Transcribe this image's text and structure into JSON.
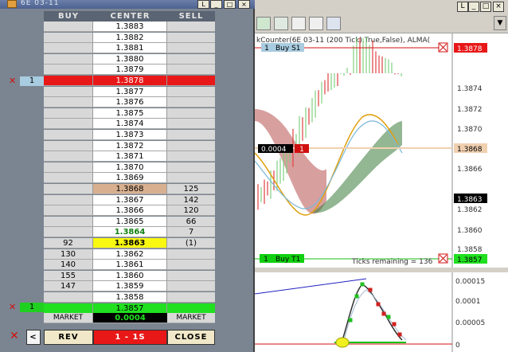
{
  "dom_window": {
    "title": "6E 03-11",
    "headers": {
      "buy": "BUY",
      "center": "CENTER",
      "sell": "SELL"
    },
    "rows": [
      {
        "buy": "",
        "price": "1.3883",
        "sell": "",
        "highlight": ""
      },
      {
        "buy": "",
        "price": "1.3882",
        "sell": "",
        "highlight": ""
      },
      {
        "buy": "",
        "price": "1.3881",
        "sell": "",
        "highlight": ""
      },
      {
        "buy": "",
        "price": "1.3880",
        "sell": "",
        "highlight": ""
      },
      {
        "buy": "",
        "price": "1.3879",
        "sell": "",
        "highlight": ""
      },
      {
        "buy": "",
        "price": "1.3878",
        "sell": "",
        "highlight": "red"
      },
      {
        "buy": "",
        "price": "1.3877",
        "sell": "",
        "highlight": ""
      },
      {
        "buy": "",
        "price": "1.3876",
        "sell": "",
        "highlight": ""
      },
      {
        "buy": "",
        "price": "1.3875",
        "sell": "",
        "highlight": ""
      },
      {
        "buy": "",
        "price": "1.3874",
        "sell": "",
        "highlight": ""
      },
      {
        "buy": "",
        "price": "1.3873",
        "sell": "",
        "highlight": ""
      },
      {
        "buy": "",
        "price": "1.3872",
        "sell": "",
        "highlight": ""
      },
      {
        "buy": "",
        "price": "1.3871",
        "sell": "",
        "highlight": ""
      },
      {
        "buy": "",
        "price": "1.3870",
        "sell": "",
        "highlight": ""
      },
      {
        "buy": "",
        "price": "1.3869",
        "sell": "",
        "highlight": ""
      },
      {
        "buy": "",
        "price": "1.3868",
        "sell": "125",
        "highlight": "tan"
      },
      {
        "buy": "",
        "price": "1.3867",
        "sell": "142",
        "highlight": ""
      },
      {
        "buy": "",
        "price": "1.3866",
        "sell": "120",
        "highlight": ""
      },
      {
        "buy": "",
        "price": "1.3865",
        "sell": "66",
        "highlight": ""
      },
      {
        "buy": "",
        "price": "1.3864",
        "sell": "7",
        "highlight": "green-text"
      },
      {
        "buy": "92",
        "price": "1.3863",
        "sell": "(1)",
        "highlight": "yellow"
      },
      {
        "buy": "130",
        "price": "1.3862",
        "sell": "",
        "highlight": ""
      },
      {
        "buy": "140",
        "price": "1.3861",
        "sell": "",
        "highlight": ""
      },
      {
        "buy": "155",
        "price": "1.3860",
        "sell": "",
        "highlight": ""
      },
      {
        "buy": "147",
        "price": "1.3859",
        "sell": "",
        "highlight": ""
      },
      {
        "buy": "",
        "price": "1.3858",
        "sell": "",
        "highlight": ""
      },
      {
        "buy": "",
        "price": "1.3857",
        "sell": "",
        "highlight": "green"
      }
    ],
    "market_row": {
      "buy": "MARKET",
      "center": "0.0004",
      "sell": "MARKET"
    },
    "order_qty_top": "1",
    "order_qty_bottom": "1",
    "bottom": {
      "rev_label": "REV",
      "position_label": "1 - 1S",
      "close_label": "CLOSE",
      "arrow_label": "<"
    }
  },
  "chart_window": {
    "title_text": "kCounter(6E 03-11 (200 Tick),True,False), ALMA(",
    "buy_s1_qty": "1",
    "buy_s1_label": "Buy S1",
    "buy_t1_qty": "1",
    "buy_t1_label": "Buy T1",
    "offset_label": "0.0004",
    "offset_qty": "1",
    "ticks_remaining": "Ticks remaining = 136",
    "price_axis": [
      "1.3878",
      "1.3874",
      "1.3872",
      "1.3870",
      "1.3868",
      "1.3866",
      "1.3863",
      "1.3862",
      "1.3860",
      "1.3858",
      "1.3857"
    ],
    "osc_axis": [
      "0.00015",
      "0.0001",
      "0.00005",
      "0"
    ]
  }
}
